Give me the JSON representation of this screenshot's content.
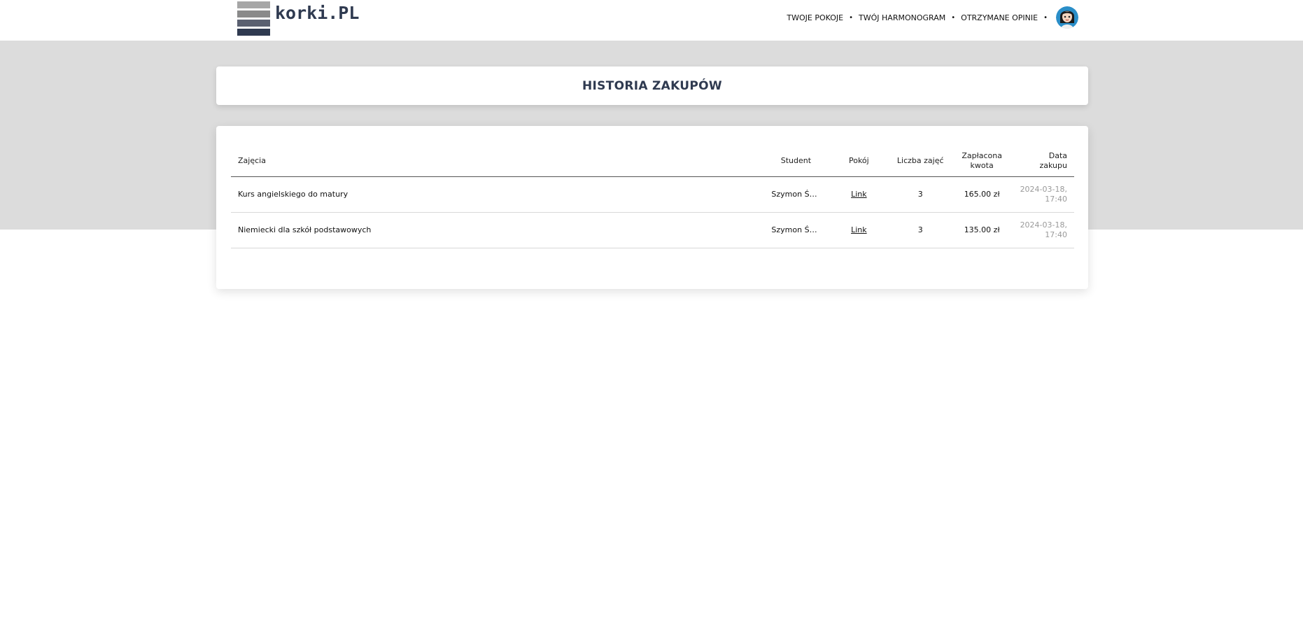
{
  "header": {
    "logo_text": "korki.PL",
    "nav": [
      {
        "label": "TWOJE POKOJE"
      },
      {
        "label": "TWÓJ HARMONOGRAM"
      },
      {
        "label": "OTRZYMANE OPINIE"
      }
    ],
    "nav_separator": "•"
  },
  "page": {
    "title": "HISTORIA ZAKUPÓW"
  },
  "table": {
    "headers": {
      "course": "Zajęcia",
      "student": "Student",
      "room": "Pokój",
      "count": "Liczba zajęć",
      "amount": "Zapłacona kwota",
      "date": "Data zakupu"
    },
    "rows": [
      {
        "course": "Kurs angielskiego do matury",
        "student": "Szymon Świ…",
        "room": "Link",
        "count": "3",
        "amount": "165.00 zł",
        "date": "2024-03-18, 17:40"
      },
      {
        "course": "Niemiecki dla szkół podstawowych",
        "student": "Szymon Świ…",
        "room": "Link",
        "count": "3",
        "amount": "135.00 zł",
        "date": "2024-03-18, 17:40"
      }
    ]
  },
  "colors": {
    "brand_dark": "#2f3a50",
    "band_grey": "#dcdcdc"
  }
}
